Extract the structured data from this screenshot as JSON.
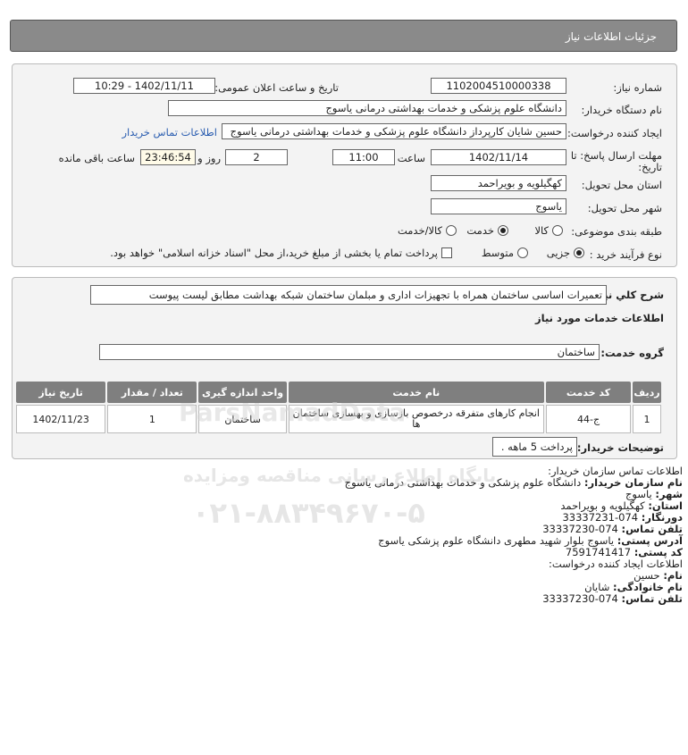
{
  "header": {
    "title": "جزئیات اطلاعات نیاز"
  },
  "form": {
    "need_number_label": "شماره نیاز:",
    "need_number": "1102004510000338",
    "announce_label": "تاریخ و ساعت اعلان عمومی:",
    "announce_value": "1402/11/11 - 10:29",
    "buyer_org_label": "نام دستگاه خریدار:",
    "buyer_org": "دانشگاه علوم پزشکی و خدمات بهداشتی  درمانی یاسوج",
    "creator_label": "ایجاد کننده درخواست:",
    "creator": "حسین شایان کارپرداز دانشگاه علوم پزشکی و خدمات بهداشتی  درمانی یاسوج",
    "contact_link": "اطلاعات تماس خریدار",
    "deadline_label_1": "مهلت ارسال پاسخ: تا",
    "deadline_label_2": "تاریخ:",
    "deadline_date": "1402/11/14",
    "time_label": "ساعت",
    "deadline_time": "11:00",
    "days_value": "2",
    "days_label": "روز و",
    "remaining_value": "23:46:54",
    "remaining_label": "ساعت باقی مانده",
    "province_label": "استان محل تحویل:",
    "province": "کهگیلویه و بویراحمد",
    "city_label": "شهر محل تحویل:",
    "city": "یاسوج",
    "category_label": "طبقه بندی موضوعی:",
    "category_options": [
      "کالا",
      "خدمت",
      "کالا/خدمت"
    ],
    "category_selected": "خدمت",
    "process_label": "نوع فرآیند خرید :",
    "process_options": [
      "جزیی",
      "متوسط"
    ],
    "process_selected": "جزیی",
    "payment_note": "پرداخت تمام یا بخشی از مبلغ خرید،از محل \"اسناد خزانه اسلامی\" خواهد بود."
  },
  "details": {
    "summary_label": "شرح کلي نياز:",
    "summary": "تعمیرات اساسی ساختمان همراه با تجهیزات اداری و مبلمان ساختمان شبکه بهداشت مطابق لیست پیوست",
    "services_title": "اطلاعات خدمات مورد نیاز",
    "service_group_label": "گروه خدمت:",
    "service_group": "ساختمان",
    "table": {
      "headers": [
        "ردیف",
        "کد خدمت",
        "نام خدمت",
        "واحد اندازه گیری",
        "تعداد / مقدار",
        "تاریخ نیاز"
      ],
      "rows": [
        {
          "row": "1",
          "code": "ج-44",
          "name": "انجام کارهای متفرقه درخصوص بازسازی و بهسازی ساختمان ها",
          "unit": "ساختمان",
          "qty": "1",
          "date": "1402/11/23"
        }
      ]
    },
    "buyer_notes_label": "توضیحات خریدار:",
    "buyer_notes": "پرداخت 5 ماهه ."
  },
  "contact": {
    "title": "اطلاعات تماس سازمان خریدار:",
    "org_label": "نام سازمان خریدار:",
    "org": "دانشگاه علوم پزشکی و خدمات بهداشتی درمانی یاسوج",
    "city_label": "شهر:",
    "city": "یاسوج",
    "province_label": "استان:",
    "province": "کهگیلویه و بویراحمد",
    "fax_label": "دورنگار:",
    "fax": "074-33337231",
    "phone_label": "تلفن تماس:",
    "phone": "074-33337230",
    "address_label": "آدرس پستی:",
    "address": "یاسوج بلوار شهید مطهری دانشگاه علوم پزشکی یاسوج",
    "postal_label": "کد پستی:",
    "postal": "7591741417",
    "creator_title": "اطلاعات ایجاد کننده درخواست:",
    "first_name_label": "نام:",
    "first_name": "حسین",
    "last_name_label": "نام خانوادگی:",
    "last_name": "شایان",
    "creator_phone_label": "تلفن تماس:",
    "creator_phone": "074-33337230"
  },
  "watermark": {
    "brand": "ParsNamadData",
    "title": "پایگاه اطلاع رسانی مناقصه ومزایده",
    "phone": "۰۲۱-۸۸۳۴۹۶۷۰-۵"
  }
}
